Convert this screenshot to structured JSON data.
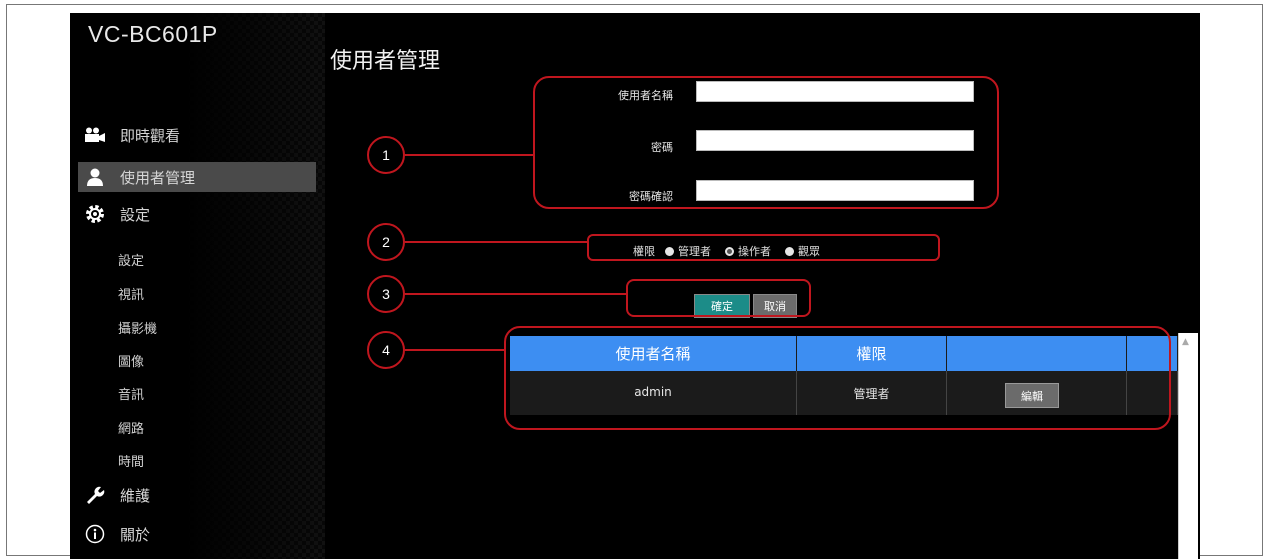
{
  "app": {
    "brand": "VC-BC601P",
    "page_title": "使用者管理"
  },
  "sidebar": {
    "nav": [
      {
        "label": "即時觀看",
        "icon": "video-camera-icon"
      },
      {
        "label": "使用者管理",
        "icon": "user-icon",
        "active": true
      },
      {
        "label": "設定",
        "icon": "gear-icon"
      }
    ],
    "sub_items": [
      "設定",
      "視訊",
      "攝影機",
      "圖像",
      "音訊",
      "網路",
      "時間"
    ],
    "bottom": [
      {
        "label": "維護",
        "icon": "wrench-icon"
      },
      {
        "label": "關於",
        "icon": "info-icon"
      }
    ]
  },
  "form": {
    "username_label": "使用者名稱",
    "username_value": "",
    "password_label": "密碼",
    "password_value": "",
    "confirm_label": "密碼確認",
    "confirm_value": "",
    "permission_label": "權限",
    "permission_options": [
      "管理者",
      "操作者",
      "觀眾"
    ],
    "permission_selected": "操作者",
    "ok_label": "確定",
    "cancel_label": "取消"
  },
  "callouts": [
    "1",
    "2",
    "3",
    "4"
  ],
  "user_table": {
    "headers": [
      "使用者名稱",
      "權限",
      "",
      ""
    ],
    "rows": [
      {
        "username": "admin",
        "permission": "管理者",
        "action": "編輯"
      }
    ]
  },
  "colors": {
    "accent_blue": "#3d8ef2",
    "ok_button": "#1c8c88",
    "callout_red": "#c0161e"
  }
}
